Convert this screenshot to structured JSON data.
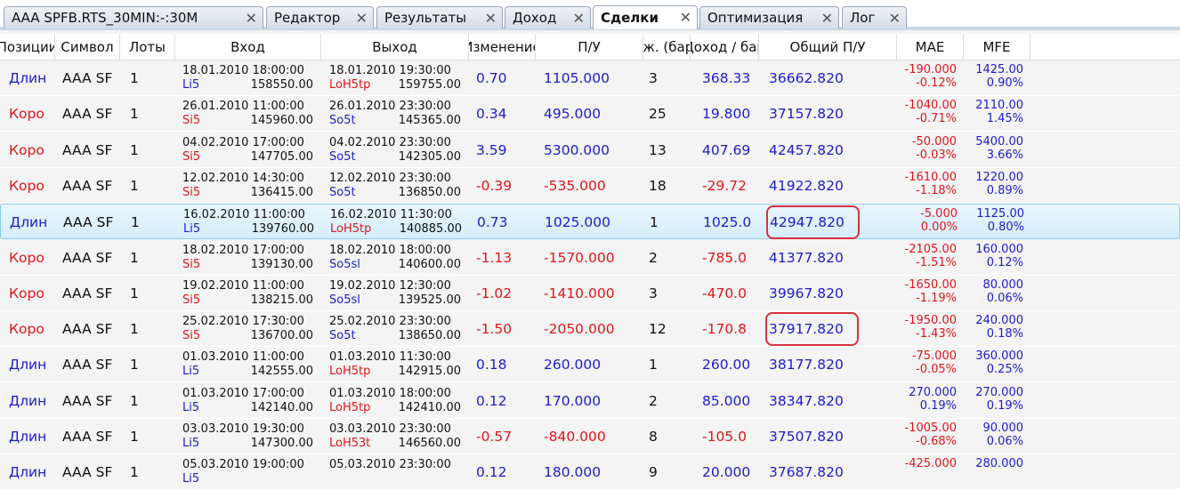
{
  "tabs": [
    {
      "label": "AAA SPFB.RTS_30MIN:-:30M",
      "active": false
    },
    {
      "label": "Редактор",
      "active": false
    },
    {
      "label": "Результаты",
      "active": false
    },
    {
      "label": "Доход",
      "active": false
    },
    {
      "label": "Сделки",
      "active": true
    },
    {
      "label": "Оптимизация",
      "active": false
    },
    {
      "label": "Лог",
      "active": false
    }
  ],
  "close_glyph": "✕",
  "columns": [
    "Позиции",
    "Символ",
    "Лоты",
    "Вход",
    "Выход",
    "Изменение",
    "П/У",
    "Длж. (бары)",
    "Доход / бар",
    "Общий П/У",
    "MAE",
    "MFE"
  ],
  "colors": {
    "positive": "#1c1ccc",
    "negative": "#e0161a",
    "highlight": "#d8323c"
  },
  "rows": [
    {
      "pos": "Длин",
      "sym": "AAA SF",
      "lots": "1",
      "in_date": "18.01.2010 18:00:00",
      "in_sig": "Li5",
      "in_price": "158550.00",
      "out_date": "18.01.2010 19:30:00",
      "out_sig": "LoH5tp",
      "out_price": "159755.00",
      "chg": "0.70",
      "pnl": "1105.000",
      "bars": "3",
      "per_bar": "368.33",
      "total": "36662.820",
      "mae": "-190.000",
      "mae_pct": "-0.12%",
      "mfe": "1425.00",
      "mfe_pct": "0.90%"
    },
    {
      "pos": "Коро",
      "sym": "AAA SF",
      "lots": "1",
      "in_date": "26.01.2010 11:00:00",
      "in_sig": "Si5",
      "in_price": "145960.00",
      "out_date": "26.01.2010 23:30:00",
      "out_sig": "So5t",
      "out_price": "145365.00",
      "chg": "0.34",
      "pnl": "495.000",
      "bars": "25",
      "per_bar": "19.800",
      "total": "37157.820",
      "mae": "-1040.00",
      "mae_pct": "-0.71%",
      "mfe": "2110.00",
      "mfe_pct": "1.45%"
    },
    {
      "pos": "Коро",
      "sym": "AAA SF",
      "lots": "1",
      "in_date": "04.02.2010 17:00:00",
      "in_sig": "Si5",
      "in_price": "147705.00",
      "out_date": "04.02.2010 23:30:00",
      "out_sig": "So5t",
      "out_price": "142305.00",
      "chg": "3.59",
      "pnl": "5300.000",
      "bars": "13",
      "per_bar": "407.69",
      "total": "42457.820",
      "mae": "-50.000",
      "mae_pct": "-0.03%",
      "mfe": "5400.00",
      "mfe_pct": "3.66%"
    },
    {
      "pos": "Коро",
      "sym": "AAA SF",
      "lots": "1",
      "in_date": "12.02.2010 14:30:00",
      "in_sig": "Si5",
      "in_price": "136415.00",
      "out_date": "12.02.2010 23:30:00",
      "out_sig": "So5t",
      "out_price": "136850.00",
      "chg": "-0.39",
      "pnl": "-535.000",
      "bars": "18",
      "per_bar": "-29.72",
      "total": "41922.820",
      "mae": "-1610.00",
      "mae_pct": "-1.18%",
      "mfe": "1220.00",
      "mfe_pct": "0.89%"
    },
    {
      "pos": "Длин",
      "sym": "AAA SF",
      "lots": "1",
      "in_date": "16.02.2010 11:00:00",
      "in_sig": "Li5",
      "in_price": "139760.00",
      "out_date": "16.02.2010 11:30:00",
      "out_sig": "LoH5tp",
      "out_price": "140885.00",
      "chg": "0.73",
      "pnl": "1025.000",
      "bars": "1",
      "per_bar": "1025.0",
      "total": "42947.820",
      "mae": "-5.000",
      "mae_pct": "0.00%",
      "mfe": "1125.00",
      "mfe_pct": "0.80%",
      "selected": true,
      "circled": true
    },
    {
      "pos": "Коро",
      "sym": "AAA SF",
      "lots": "1",
      "in_date": "18.02.2010 17:00:00",
      "in_sig": "Si5",
      "in_price": "139130.00",
      "out_date": "18.02.2010 18:00:00",
      "out_sig": "So5sl",
      "out_price": "140600.00",
      "chg": "-1.13",
      "pnl": "-1570.000",
      "bars": "2",
      "per_bar": "-785.0",
      "total": "41377.820",
      "mae": "-2105.00",
      "mae_pct": "-1.51%",
      "mfe": "160.000",
      "mfe_pct": "0.12%"
    },
    {
      "pos": "Коро",
      "sym": "AAA SF",
      "lots": "1",
      "in_date": "19.02.2010 11:00:00",
      "in_sig": "Si5",
      "in_price": "138215.00",
      "out_date": "19.02.2010 12:30:00",
      "out_sig": "So5sl",
      "out_price": "139525.00",
      "chg": "-1.02",
      "pnl": "-1410.000",
      "bars": "3",
      "per_bar": "-470.0",
      "total": "39967.820",
      "mae": "-1650.00",
      "mae_pct": "-1.19%",
      "mfe": "80.000",
      "mfe_pct": "0.06%"
    },
    {
      "pos": "Коро",
      "sym": "AAA SF",
      "lots": "1",
      "in_date": "25.02.2010 17:30:00",
      "in_sig": "Si5",
      "in_price": "136700.00",
      "out_date": "25.02.2010 23:30:00",
      "out_sig": "So5t",
      "out_price": "138650.00",
      "chg": "-1.50",
      "pnl": "-2050.000",
      "bars": "12",
      "per_bar": "-170.8",
      "total": "37917.820",
      "mae": "-1950.00",
      "mae_pct": "-1.43%",
      "mfe": "240.000",
      "mfe_pct": "0.18%",
      "circled": true
    },
    {
      "pos": "Длин",
      "sym": "AAA SF",
      "lots": "1",
      "in_date": "01.03.2010 11:00:00",
      "in_sig": "Li5",
      "in_price": "142555.00",
      "out_date": "01.03.2010 11:30:00",
      "out_sig": "LoH5tp",
      "out_price": "142915.00",
      "chg": "0.18",
      "pnl": "260.000",
      "bars": "1",
      "per_bar": "260.00",
      "total": "38177.820",
      "mae": "-75.000",
      "mae_pct": "-0.05%",
      "mfe": "360.000",
      "mfe_pct": "0.25%"
    },
    {
      "pos": "Длин",
      "sym": "AAA SF",
      "lots": "1",
      "in_date": "01.03.2010 17:00:00",
      "in_sig": "Li5",
      "in_price": "142140.00",
      "out_date": "01.03.2010 18:00:00",
      "out_sig": "LoH5tp",
      "out_price": "142410.00",
      "chg": "0.12",
      "pnl": "170.000",
      "bars": "2",
      "per_bar": "85.000",
      "total": "38347.820",
      "mae": "270.000",
      "mae_pct": "0.19%",
      "mfe": "270.000",
      "mfe_pct": "0.19%"
    },
    {
      "pos": "Длин",
      "sym": "AAA SF",
      "lots": "1",
      "in_date": "03.03.2010 19:30:00",
      "in_sig": "Li5",
      "in_price": "147300.00",
      "out_date": "03.03.2010 23:30:00",
      "out_sig": "LoH53t",
      "out_price": "146560.00",
      "chg": "-0.57",
      "pnl": "-840.000",
      "bars": "8",
      "per_bar": "-105.0",
      "total": "37507.820",
      "mae": "-1005.00",
      "mae_pct": "-0.68%",
      "mfe": "90.000",
      "mfe_pct": "0.06%"
    },
    {
      "pos": "Длин",
      "sym": "AAA SF",
      "lots": "1",
      "in_date": "05.03.2010 19:00:00",
      "in_sig": "Li5",
      "in_price": "",
      "out_date": "05.03.2010 23:30:00",
      "out_sig": "",
      "out_price": "",
      "chg": "0.12",
      "pnl": "180.000",
      "bars": "9",
      "per_bar": "20.000",
      "total": "37687.820",
      "mae": "-425.000",
      "mae_pct": "",
      "mfe": "280.000",
      "mfe_pct": ""
    }
  ]
}
